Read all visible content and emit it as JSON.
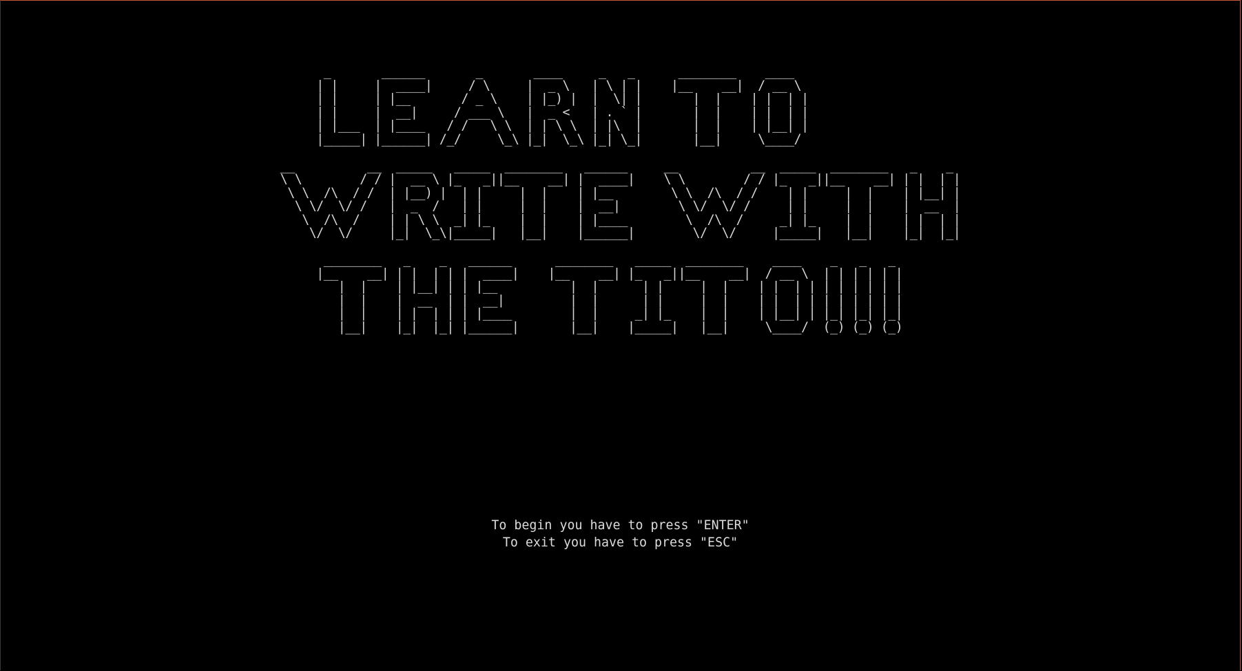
{
  "banner": {
    "ascii_art": "      _       ______       _       ____     _   _      ________    ____\n     | |     |  ____|     / \\     |  _ \\   | \\ | |    |__    __|  / __ \\\n     | |     | |__       / _ \\    | |_) |  |  \\| |       |  |    | |  | |\n     | |     |  __|     / ___ \\   |  _ <   | . ` |       |  |    | |  | |\n     | |___  | |____   / /   \\ \\  | | \\ \\  | |\\  |       |  |    | |__| |\n     |_____| |______| /_/     \\_\\ |_|  \\_\\ |_| \\_|       |__|     \\____/\n\n__          __  _____   _____  ________   ______     __          __  _____  ________   _    _\n\\ \\        / / |  __ \\ |_   _||__    __| |  ____|    \\ \\        / / |_   _||__    __| | |  | |\n \\ \\  /\\  / /  | |__) |  | |     |  |    | |__        \\ \\  /\\  / /    | |     |  |    | |__| |\n  \\ \\/  \\/ /   |  _  /   | |     |  |    |  __|        \\ \\/  \\/ /     | |     |  |    |  __  |\n   \\  /\\  /    | | \\ \\  _| |_    |  |    | |____        \\  /\\  /     _| |_    |  |    | |  | |\n    \\/  \\/     |_|  \\_\\|_____|   |__|    |______|        \\/  \\/     |_____|   |__|    |_|  |_|\n\n      ________   _    _   ______      ________   _____  ________    ____    _   _   _\n     |__    __| | |  | | |  ____|    |__    __| |_   _||__    __|  / __ \\  | | | | | |\n        |  |    | |__| | | |__          |  |      | |     |  |    | |  | | | | | | | |\n        |  |    |  __  | |  __|         |  |      | |     |  |    | |  | | | | | | | |\n        |  |    | |  | | | |____        |  |     _| |_    |  |    | |__| | |_| |_| |_|\n        |__|    |_|  |_| |______|       |__|    |_____|   |__|     \\____/  (_) (_) (_)"
  },
  "instructions": {
    "begin": "To begin you have to press \"ENTER\"",
    "exit": "To exit you have to press \"ESC\""
  },
  "colors": {
    "background": "#000000",
    "text": "#d6d6d6",
    "window_border": "#c8573a"
  }
}
